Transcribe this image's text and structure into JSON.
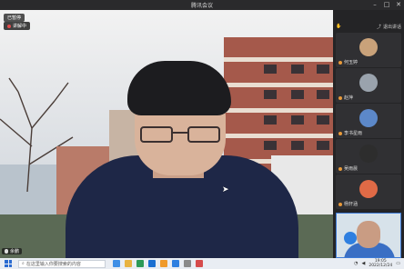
{
  "window": {
    "title": "腾讯会议",
    "controls": [
      "minimize",
      "maximize",
      "close"
    ]
  },
  "main_video": {
    "sharing_badge": "已暂停",
    "sharing_text": "讲解中",
    "speaker_name": "余鹏",
    "layout": "speaker-view"
  },
  "sidebar": {
    "exit_label": "退出讲话",
    "participants": [
      {
        "name": "何玉婷",
        "avatar_color": "#c9a27a"
      },
      {
        "name": "赵萍",
        "avatar_color": "#9aa3ad"
      },
      {
        "name": "李书星雨",
        "avatar_color": "#5c88c9"
      },
      {
        "name": "吴雨晨",
        "avatar_color": "#2d2d2d"
      },
      {
        "name": "杨轩涵",
        "avatar_color": "#e06a46"
      }
    ]
  },
  "taskbar": {
    "search_placeholder": "在这里输入你要搜索的内容",
    "time": "19:05",
    "date": "2022/12/24",
    "app_icons": [
      "#3f8fe6",
      "#e8b341",
      "#2c9a58",
      "#1b6fd1",
      "#f09a2b",
      "#2e7fe0",
      "#8a8a8a",
      "#d64b4b"
    ]
  },
  "colors": {
    "accent": "#2e7fe0",
    "titlebar": "#2a2a2c",
    "sidebar": "#242426"
  }
}
